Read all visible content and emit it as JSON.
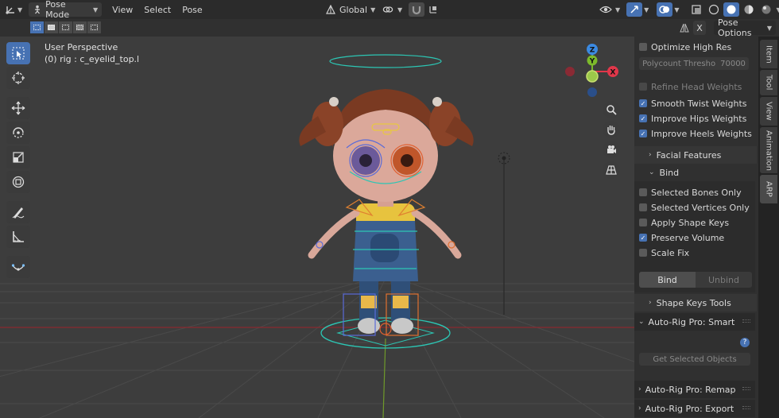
{
  "header": {
    "editor_type_icon": "axes-icon",
    "mode": "Pose Mode",
    "menus": [
      "View",
      "Select",
      "Pose"
    ],
    "transform_orientation": "Global",
    "pivot_icon": "link-icon",
    "snap_icon": "magnet-icon"
  },
  "subheader": {
    "x_label": "X",
    "pose_options": "Pose Options"
  },
  "viewport": {
    "perspective": "User Perspective",
    "active_object": "(0) rig : c_eyelid_top.l",
    "gizmo": {
      "z": "Z",
      "y": "Y",
      "x": "X"
    }
  },
  "panel": {
    "optimize_high_res": "Optimize High Res",
    "polycount_label": "Polycount Thresho",
    "polycount_value": "70000",
    "refine_head_weights": "Refine Head Weights",
    "smooth_twist_weights": "Smooth Twist Weights",
    "improve_hips_weights": "Improve Hips Weights",
    "improve_heels_weights": "Improve Heels Weights",
    "facial_features": "Facial Features",
    "bind_section": "Bind",
    "selected_bones_only": "Selected Bones Only",
    "selected_vertices_only": "Selected Vertices Only",
    "apply_shape_keys": "Apply Shape Keys",
    "preserve_volume": "Preserve Volume",
    "scale_fix": "Scale Fix",
    "bind_button": "Bind",
    "unbind_button": "Unbind",
    "shape_keys_tools": "Shape Keys Tools",
    "smart_section": "Auto-Rig Pro: Smart",
    "help_glyph": "?",
    "get_selected_objects": "Get Selected Objects",
    "remap_section": "Auto-Rig Pro: Remap",
    "export_section": "Auto-Rig Pro: Export"
  },
  "tabs": [
    "Item",
    "Tool",
    "View",
    "Animation",
    "ARP"
  ],
  "colors": {
    "accent": "#4772b3",
    "axis_x": "#e1374a",
    "axis_y": "#7cba2b",
    "axis_z": "#3b8ae2",
    "viewport_bg": "#3d3d3d"
  }
}
